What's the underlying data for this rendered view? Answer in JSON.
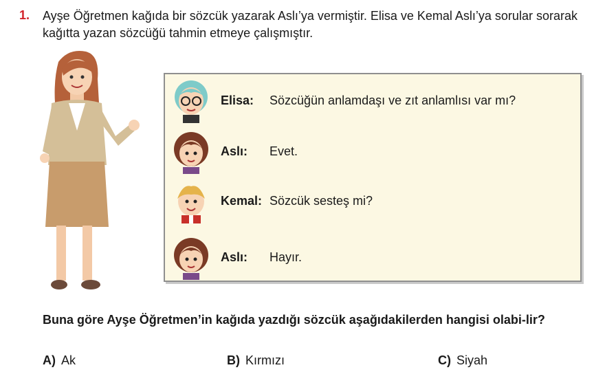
{
  "question": {
    "number": "1.",
    "stem": "Ayşe Öğretmen kağıda bir sözcük yazarak Aslı’ya vermiştir. Elisa ve Kemal Aslı’ya sorular sorarak kağıtta yazan sözcüğü tahmin etmeye çalışmıştır.",
    "prompt": "Buna göre Ayşe Öğretmen’in kağıda yazdığı sözcük aşağıdakilerden hangisi olabi-lir?"
  },
  "dialog": [
    {
      "speaker": "Elisa:",
      "text": "Sözcüğün anlamdaşı ve zıt anlamlısı var mı?",
      "avatar": "girl-glasses-avatar"
    },
    {
      "speaker": "Aslı:",
      "text": "Evet.",
      "avatar": "girl-avatar"
    },
    {
      "speaker": "Kemal:",
      "text": "Sözcük sesteş mi?",
      "avatar": "boy-avatar"
    },
    {
      "speaker": "Aslı:",
      "text": "Hayır.",
      "avatar": "girl-avatar"
    }
  ],
  "options": [
    {
      "label": "A)",
      "text": "Ak"
    },
    {
      "label": "B)",
      "text": "Kırmızı"
    },
    {
      "label": "C)",
      "text": "Siyah"
    }
  ],
  "colors": {
    "number": "#d2232a",
    "dialog_bg": "#fcf8e3",
    "dialog_border": "#8f8f8f"
  }
}
